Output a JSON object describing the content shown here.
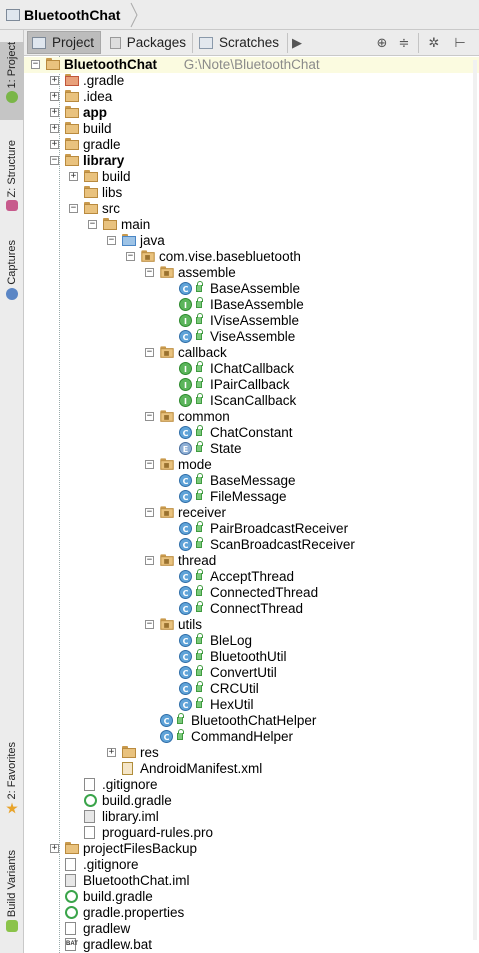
{
  "breadcrumb": {
    "project": "BluetoothChat"
  },
  "toolbar": {
    "tabs": [
      {
        "label": "Project",
        "icon": "project-icon"
      },
      {
        "label": "Packages",
        "icon": "packages-icon"
      },
      {
        "label": "Scratches",
        "icon": "scratches-icon"
      }
    ],
    "more_icon": "▶",
    "sync_icon": "⊕",
    "collapse_icon": "≑",
    "gear_icon": "✲",
    "hide_icon": "⊢"
  },
  "sidebar": {
    "tabs": [
      {
        "label": "1: Project"
      },
      {
        "label": "Z: Structure"
      },
      {
        "label": "Captures"
      },
      {
        "label": "2: Favorites"
      },
      {
        "label": "Build Variants"
      }
    ]
  },
  "tree": [
    {
      "label": "BluetoothChat",
      "hint": "G:\\Note\\BluetoothChat",
      "level": 0,
      "icon": "folder",
      "open": true,
      "bold": true
    },
    {
      "label": ".gradle",
      "level": 1,
      "icon": "folder-excluded",
      "open": false
    },
    {
      "label": ".idea",
      "level": 1,
      "icon": "folder",
      "open": false
    },
    {
      "label": "app",
      "level": 1,
      "icon": "folder",
      "open": false,
      "bold": true
    },
    {
      "label": "build",
      "level": 1,
      "icon": "folder",
      "open": false
    },
    {
      "label": "gradle",
      "level": 1,
      "icon": "folder",
      "open": false
    },
    {
      "label": "library",
      "level": 1,
      "icon": "folder",
      "open": true,
      "bold": true
    },
    {
      "label": "build",
      "level": 2,
      "icon": "folder",
      "open": false
    },
    {
      "label": "libs",
      "level": 2,
      "icon": "folder"
    },
    {
      "label": "src",
      "level": 2,
      "icon": "folder",
      "open": true
    },
    {
      "label": "main",
      "level": 3,
      "icon": "folder",
      "open": true
    },
    {
      "label": "java",
      "level": 4,
      "icon": "folder-source",
      "open": true
    },
    {
      "label": "com.vise.basebluetooth",
      "level": 5,
      "icon": "package",
      "open": true
    },
    {
      "label": "assemble",
      "level": 6,
      "icon": "package",
      "open": true
    },
    {
      "label": "BaseAssemble",
      "level": 7,
      "icon": "class"
    },
    {
      "label": "IBaseAssemble",
      "level": 7,
      "icon": "interface"
    },
    {
      "label": "IViseAssemble",
      "level": 7,
      "icon": "interface"
    },
    {
      "label": "ViseAssemble",
      "level": 7,
      "icon": "class"
    },
    {
      "label": "callback",
      "level": 6,
      "icon": "package",
      "open": true
    },
    {
      "label": "IChatCallback",
      "level": 7,
      "icon": "interface"
    },
    {
      "label": "IPairCallback",
      "level": 7,
      "icon": "interface"
    },
    {
      "label": "IScanCallback",
      "level": 7,
      "icon": "interface"
    },
    {
      "label": "common",
      "level": 6,
      "icon": "package",
      "open": true
    },
    {
      "label": "ChatConstant",
      "level": 7,
      "icon": "class"
    },
    {
      "label": "State",
      "level": 7,
      "icon": "enum"
    },
    {
      "label": "mode",
      "level": 6,
      "icon": "package",
      "open": true
    },
    {
      "label": "BaseMessage",
      "level": 7,
      "icon": "class"
    },
    {
      "label": "FileMessage",
      "level": 7,
      "icon": "class"
    },
    {
      "label": "receiver",
      "level": 6,
      "icon": "package",
      "open": true
    },
    {
      "label": "PairBroadcastReceiver",
      "level": 7,
      "icon": "class"
    },
    {
      "label": "ScanBroadcastReceiver",
      "level": 7,
      "icon": "class"
    },
    {
      "label": "thread",
      "level": 6,
      "icon": "package",
      "open": true
    },
    {
      "label": "AcceptThread",
      "level": 7,
      "icon": "class"
    },
    {
      "label": "ConnectedThread",
      "level": 7,
      "icon": "class"
    },
    {
      "label": "ConnectThread",
      "level": 7,
      "icon": "class"
    },
    {
      "label": "utils",
      "level": 6,
      "icon": "package",
      "open": true
    },
    {
      "label": "BleLog",
      "level": 7,
      "icon": "class"
    },
    {
      "label": "BluetoothUtil",
      "level": 7,
      "icon": "class"
    },
    {
      "label": "ConvertUtil",
      "level": 7,
      "icon": "class"
    },
    {
      "label": "CRCUtil",
      "level": 7,
      "icon": "class"
    },
    {
      "label": "HexUtil",
      "level": 7,
      "icon": "class"
    },
    {
      "label": "BluetoothChatHelper",
      "level": 6,
      "icon": "class"
    },
    {
      "label": "CommandHelper",
      "level": 6,
      "icon": "class"
    },
    {
      "label": "res",
      "level": 4,
      "icon": "folder-res",
      "open": false
    },
    {
      "label": "AndroidManifest.xml",
      "level": 4,
      "icon": "xml"
    },
    {
      "label": ".gitignore",
      "level": 2,
      "icon": "text"
    },
    {
      "label": "build.gradle",
      "level": 2,
      "icon": "gradle"
    },
    {
      "label": "library.iml",
      "level": 2,
      "icon": "iml"
    },
    {
      "label": "proguard-rules.pro",
      "level": 2,
      "icon": "text"
    },
    {
      "label": "projectFilesBackup",
      "level": 1,
      "icon": "folder",
      "open": false
    },
    {
      "label": ".gitignore",
      "level": 1,
      "icon": "text"
    },
    {
      "label": "BluetoothChat.iml",
      "level": 1,
      "icon": "iml"
    },
    {
      "label": "build.gradle",
      "level": 1,
      "icon": "gradle"
    },
    {
      "label": "gradle.properties",
      "level": 1,
      "icon": "gradle"
    },
    {
      "label": "gradlew",
      "level": 1,
      "icon": "text"
    },
    {
      "label": "gradlew.bat",
      "level": 1,
      "icon": "bat",
      "icon_text": "BAT"
    }
  ]
}
